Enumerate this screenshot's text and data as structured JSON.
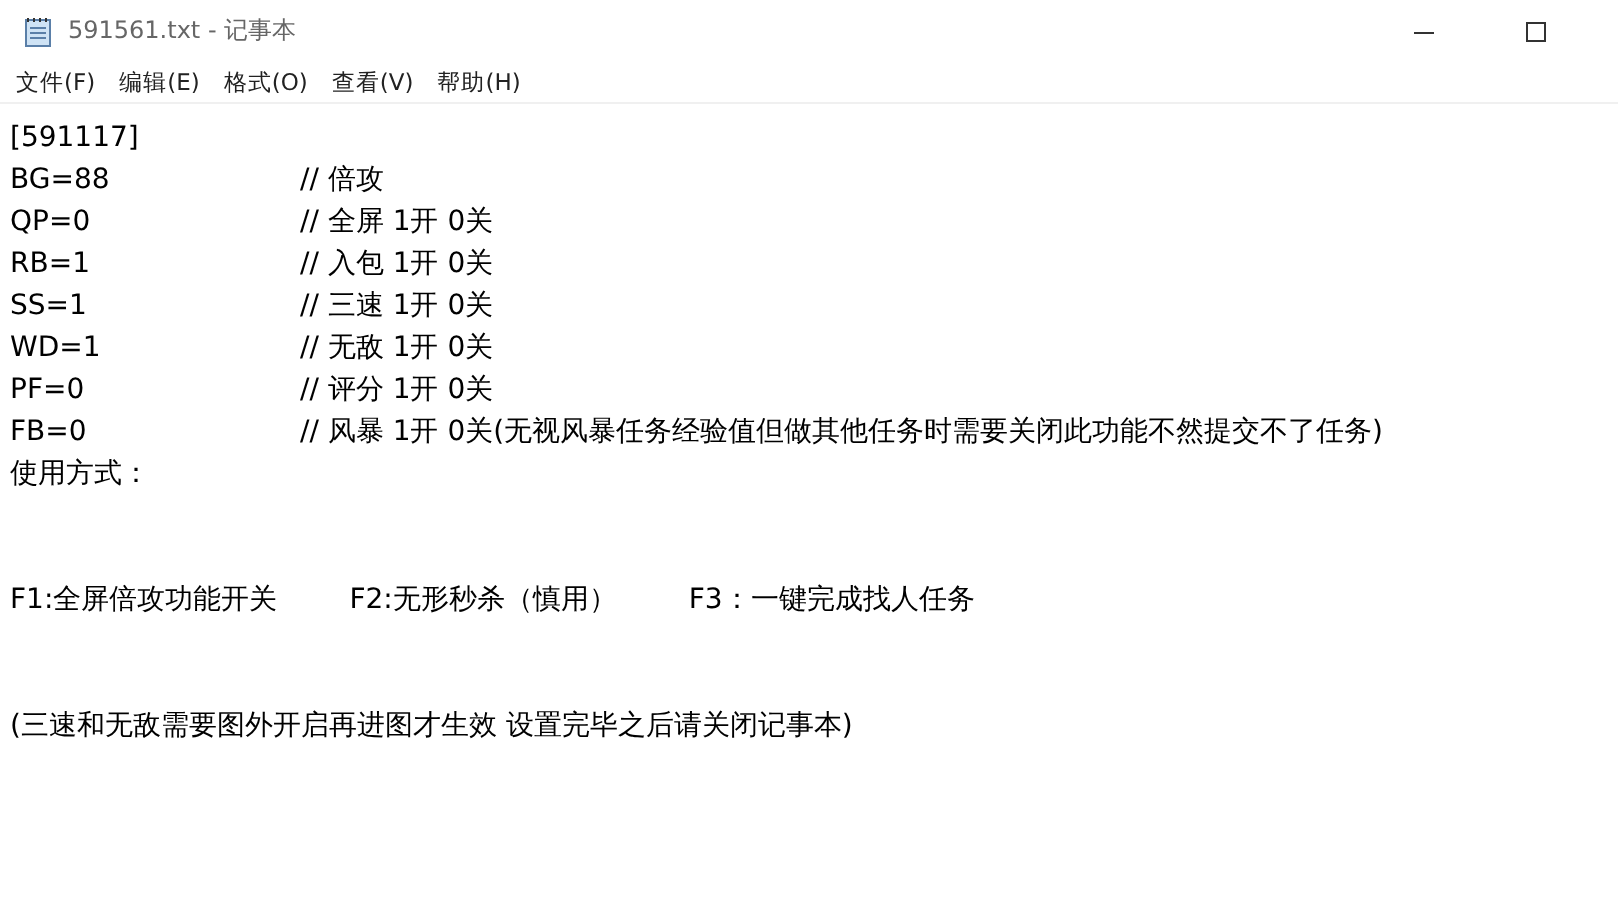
{
  "window": {
    "title": "591561.txt - 记事本"
  },
  "menu": [
    "文件(F)",
    "编辑(E)",
    "格式(O)",
    "查看(V)",
    "帮助(H)"
  ],
  "lines": [
    {
      "kind": "text",
      "text": "[591117]"
    },
    {
      "kind": "setting",
      "text": "BG=88",
      "comment": "// 倍攻"
    },
    {
      "kind": "setting",
      "text": "QP=0",
      "comment": "// 全屏 1开 0关"
    },
    {
      "kind": "setting",
      "text": "RB=1",
      "comment": "// 入包 1开 0关"
    },
    {
      "kind": "setting",
      "text": "SS=1",
      "comment": "// 三速 1开 0关"
    },
    {
      "kind": "setting",
      "text": "WD=1",
      "comment": "// 无敌 1开 0关"
    },
    {
      "kind": "setting",
      "text": "PF=0",
      "comment": "// 评分 1开 0关"
    },
    {
      "kind": "setting",
      "text": "FB=0",
      "comment": "// 风暴 1开 0关(无视风暴任务经验值但做其他任务时需要关闭此功能不然提交不了任务)"
    },
    {
      "kind": "text",
      "text": "使用方式："
    },
    {
      "kind": "blank"
    },
    {
      "kind": "blank"
    },
    {
      "kind": "hotkeys",
      "items": [
        "F1:全屏倍攻功能开关",
        "F2:无形秒杀（慎用）",
        "F3：一键完成找人任务"
      ]
    },
    {
      "kind": "blank"
    },
    {
      "kind": "blank"
    },
    {
      "kind": "text",
      "text": "(三速和无敌需要图外开启再进图才生效 设置完毕之后请关闭记事本)"
    }
  ]
}
